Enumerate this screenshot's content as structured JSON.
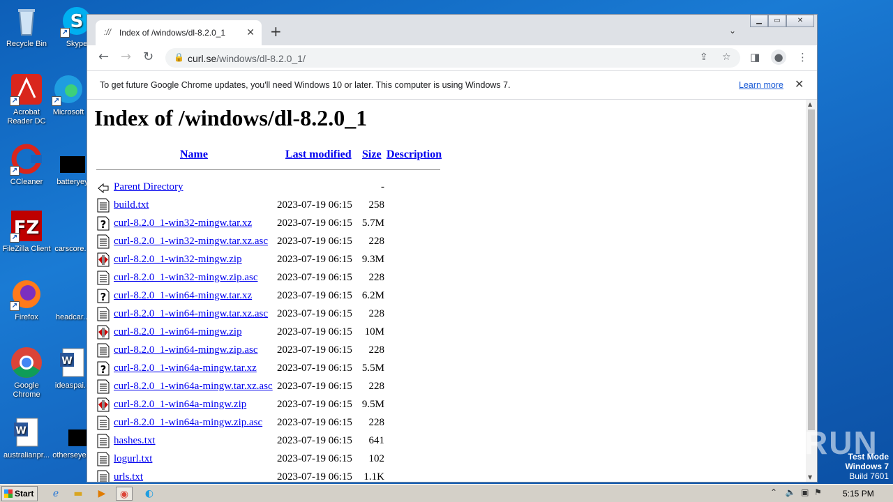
{
  "desktop": {
    "icons": [
      {
        "label": "Recycle Bin"
      },
      {
        "label": "Skype"
      },
      {
        "label": "Acrobat Reader DC"
      },
      {
        "label": "Microsoft"
      },
      {
        "label": "CCleaner"
      },
      {
        "label": "batteryey"
      },
      {
        "label": "FileZilla Client"
      },
      {
        "label": "carscore..."
      },
      {
        "label": "Firefox"
      },
      {
        "label": "headcar..."
      },
      {
        "label": "Google Chrome"
      },
      {
        "label": "ideaspai..."
      },
      {
        "label": "australianpr..."
      },
      {
        "label": "otherseye..."
      }
    ]
  },
  "browser": {
    "tab_title": "Index of /windows/dl-8.2.0_1",
    "url_host": "curl.se",
    "url_path": "/windows/dl-8.2.0_1/",
    "infobar_message": "To get future Google Chrome updates, you'll need Windows 10 or later. This computer is using Windows 7.",
    "infobar_link": "Learn more"
  },
  "page": {
    "heading": "Index of /windows/dl-8.2.0_1",
    "columns": {
      "name": "Name",
      "modified": "Last modified",
      "size": "Size",
      "description": "Description"
    },
    "files": [
      {
        "name": "Parent Directory",
        "date": "",
        "size": "-",
        "icon": "back-icon"
      },
      {
        "name": "build.txt",
        "date": "2023-07-19 06:15",
        "size": "258",
        "icon": "text-file-icon"
      },
      {
        "name": "curl-8.2.0_1-win32-mingw.tar.xz",
        "date": "2023-07-19 06:15",
        "size": "5.7M",
        "icon": "unknown-file-icon"
      },
      {
        "name": "curl-8.2.0_1-win32-mingw.tar.xz.asc",
        "date": "2023-07-19 06:15",
        "size": "228",
        "icon": "text-file-icon"
      },
      {
        "name": "curl-8.2.0_1-win32-mingw.zip",
        "date": "2023-07-19 06:15",
        "size": "9.3M",
        "icon": "compressed-file-icon"
      },
      {
        "name": "curl-8.2.0_1-win32-mingw.zip.asc",
        "date": "2023-07-19 06:15",
        "size": "228",
        "icon": "text-file-icon"
      },
      {
        "name": "curl-8.2.0_1-win64-mingw.tar.xz",
        "date": "2023-07-19 06:15",
        "size": "6.2M",
        "icon": "unknown-file-icon"
      },
      {
        "name": "curl-8.2.0_1-win64-mingw.tar.xz.asc",
        "date": "2023-07-19 06:15",
        "size": "228",
        "icon": "text-file-icon"
      },
      {
        "name": "curl-8.2.0_1-win64-mingw.zip",
        "date": "2023-07-19 06:15",
        "size": "10M",
        "icon": "compressed-file-icon"
      },
      {
        "name": "curl-8.2.0_1-win64-mingw.zip.asc",
        "date": "2023-07-19 06:15",
        "size": "228",
        "icon": "text-file-icon"
      },
      {
        "name": "curl-8.2.0_1-win64a-mingw.tar.xz",
        "date": "2023-07-19 06:15",
        "size": "5.5M",
        "icon": "unknown-file-icon"
      },
      {
        "name": "curl-8.2.0_1-win64a-mingw.tar.xz.asc",
        "date": "2023-07-19 06:15",
        "size": "228",
        "icon": "text-file-icon"
      },
      {
        "name": "curl-8.2.0_1-win64a-mingw.zip",
        "date": "2023-07-19 06:15",
        "size": "9.5M",
        "icon": "compressed-file-icon"
      },
      {
        "name": "curl-8.2.0_1-win64a-mingw.zip.asc",
        "date": "2023-07-19 06:15",
        "size": "228",
        "icon": "text-file-icon"
      },
      {
        "name": "hashes.txt",
        "date": "2023-07-19 06:15",
        "size": "641",
        "icon": "text-file-icon"
      },
      {
        "name": "logurl.txt",
        "date": "2023-07-19 06:15",
        "size": "102",
        "icon": "text-file-icon"
      },
      {
        "name": "urls.txt",
        "date": "2023-07-19 06:15",
        "size": "1.1K",
        "icon": "text-file-icon"
      }
    ]
  },
  "watermark": "ANY RUN",
  "testmode": {
    "line1": "Test Mode",
    "line2": "Windows 7",
    "line3": "Build 7601"
  },
  "taskbar": {
    "start_label": "Start",
    "clock": "5:15 PM"
  },
  "colors": {
    "link": "#0000ee",
    "desktop_bg": "#1466c0",
    "chrome_frame": "#dee1e6"
  }
}
